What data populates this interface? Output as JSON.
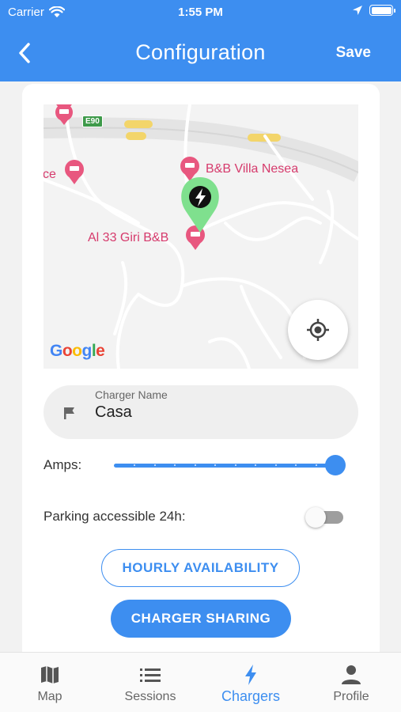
{
  "status_bar": {
    "carrier": "Carrier",
    "time": "1:55 PM",
    "icons": [
      "wifi-icon",
      "location-arrow-icon",
      "battery-icon"
    ]
  },
  "navbar": {
    "back_icon": "chevron-left-icon",
    "title": "Configuration",
    "save_label": "Save"
  },
  "map": {
    "poi_labels": [
      "B&B Villa Nesea",
      "Al 33 Giri B&B",
      "ce"
    ],
    "road_shield": "E90",
    "attribution": "Google",
    "marker_icon": "bolt-icon",
    "locate_icon": "crosshair-icon"
  },
  "form": {
    "charger_name": {
      "label": "Charger Name",
      "value": "Casa",
      "icon": "flag-icon"
    },
    "amps": {
      "label": "Amps:",
      "fraction": 1.0,
      "steps": 11
    },
    "parking": {
      "label": "Parking accessible 24h:",
      "enabled": false
    },
    "hourly_button": "HOURLY AVAILABILITY",
    "sharing_button": "CHARGER SHARING"
  },
  "tabs": [
    {
      "label": "Map",
      "icon": "map-icon",
      "active": false
    },
    {
      "label": "Sessions",
      "icon": "list-icon",
      "active": false
    },
    {
      "label": "Chargers",
      "icon": "bolt-icon",
      "active": true
    },
    {
      "label": "Profile",
      "icon": "person-icon",
      "active": false
    }
  ],
  "colors": {
    "accent": "#3d8ef0",
    "poi": "#d63a6c",
    "marker": "#7fe08e"
  }
}
